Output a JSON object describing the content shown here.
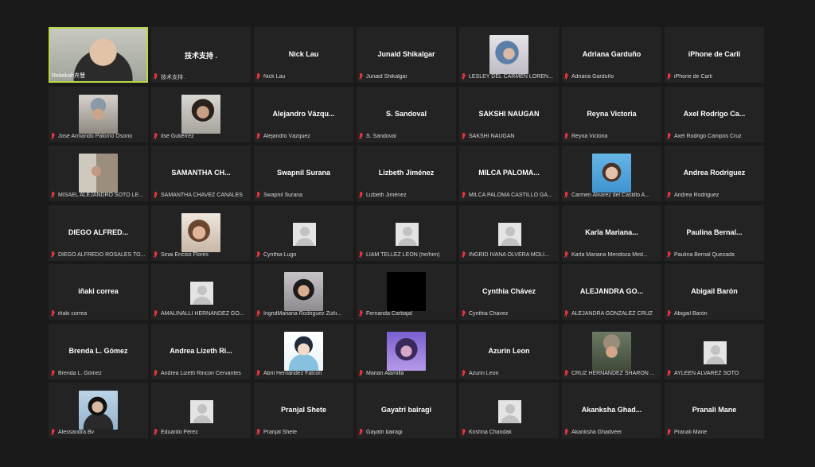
{
  "colors": {
    "background": "#1a1a1a",
    "tile": "#232323",
    "active_speaker_border": "#b8d94a",
    "muted_mic": "#e0353b"
  },
  "participants": [
    {
      "label": "Rebekah卉慧",
      "center": "",
      "avatar": "photo",
      "photo": "woman-glasses",
      "muted": false,
      "active": true
    },
    {
      "label": "技术支持 .",
      "center": "技术支持 .",
      "avatar": "none",
      "muted": true
    },
    {
      "label": "Nick Lau",
      "center": "Nick Lau",
      "avatar": "none",
      "muted": true
    },
    {
      "label": "Junaid Shikalgar",
      "center": "Junaid Shikalgar",
      "avatar": "none",
      "muted": true
    },
    {
      "label": "LESLEY DEL CARMEN LOREN...",
      "center": "",
      "avatar": "photo",
      "photo": "blue-hair",
      "muted": true
    },
    {
      "label": "Adriana Garduño",
      "center": "Adriana Garduño",
      "avatar": "none",
      "muted": true
    },
    {
      "label": "iPhone de Carli",
      "center": "iPhone de Carli",
      "avatar": "none",
      "muted": true
    },
    {
      "label": "Jose Armando Palomo Osorio",
      "center": "",
      "avatar": "photo",
      "photo": "man-cap",
      "muted": true
    },
    {
      "label": "Ilse Gutiérrez",
      "center": "",
      "avatar": "photo",
      "photo": "woman-dark",
      "muted": true
    },
    {
      "label": "Alejandro Vázquez",
      "center": "Alejandro  Vázqu...",
      "avatar": "none",
      "muted": true
    },
    {
      "label": "S. Sandoval",
      "center": "S. Sandoval",
      "avatar": "none",
      "muted": true
    },
    {
      "label": "SAKSHI NAUGAN",
      "center": "SAKSHI NAUGAN",
      "avatar": "none",
      "muted": true
    },
    {
      "label": "Reyna Victoria",
      "center": "Reyna Victoria",
      "avatar": "none",
      "muted": true
    },
    {
      "label": "Axel Rodrigo Campos Cruz",
      "center": "Axel Rodrigo Ca...",
      "avatar": "none",
      "muted": true
    },
    {
      "label": "MISAEL ALEJANDRO SOTO LE...",
      "center": "",
      "avatar": "photo",
      "photo": "man-room",
      "muted": true
    },
    {
      "label": "SAMANTHA CHAVEZ CANALES",
      "center": "SAMANTHA  CH...",
      "avatar": "none",
      "muted": true
    },
    {
      "label": "Swapnil Surana",
      "center": "Swapnil Surana",
      "avatar": "none",
      "muted": true
    },
    {
      "label": "Lizbeth Jiménez",
      "center": "Lizbeth Jiménez",
      "avatar": "none",
      "muted": true
    },
    {
      "label": "MILCA PALOMA CASTILLO GA...",
      "center": "MILCA PALOMA...",
      "avatar": "none",
      "muted": true
    },
    {
      "label": "Carmen Alvarez del Castillo A...",
      "center": "",
      "avatar": "photo",
      "photo": "woman-blue",
      "muted": true
    },
    {
      "label": "Andrea Rodriguez",
      "center": "Andrea Rodriguez",
      "avatar": "none",
      "muted": true
    },
    {
      "label": "DIEGO ALFREDO ROSALES TO...",
      "center": "DIEGO ALFRED...",
      "avatar": "none",
      "muted": true
    },
    {
      "label": "Sinai Enciso Flores",
      "center": "",
      "avatar": "photo",
      "photo": "woman-smile",
      "muted": true
    },
    {
      "label": "Cynthia Lugo",
      "center": "",
      "avatar": "default",
      "muted": true
    },
    {
      "label": "LIAM TELLEZ LEON (he/him)",
      "center": "",
      "avatar": "default",
      "muted": true
    },
    {
      "label": "INGRID IVANA OLVERA MOLI...",
      "center": "",
      "avatar": "default",
      "muted": true
    },
    {
      "label": "Karla Mariana Mendoza Med...",
      "center": "Karla  Mariana...",
      "avatar": "none",
      "muted": true
    },
    {
      "label": "Paulina Bernal Quezada",
      "center": "Paulina  Bernal...",
      "avatar": "none",
      "muted": true
    },
    {
      "label": "iñaki correa",
      "center": "iñaki correa",
      "avatar": "none",
      "muted": true
    },
    {
      "label": "AMALINALLI HERNANDEZ GO...",
      "center": "",
      "avatar": "default",
      "muted": true
    },
    {
      "label": "IngridMariana Rodriguez Zúñi...",
      "center": "",
      "avatar": "photo",
      "photo": "girl-peace",
      "muted": true
    },
    {
      "label": "Fernanda Carbajal",
      "center": "",
      "avatar": "black",
      "muted": true
    },
    {
      "label": "Cynthia Chávez",
      "center": "Cynthia Chávez",
      "avatar": "none",
      "muted": true
    },
    {
      "label": "ALEJANDRA GONZALEZ CRUZ",
      "center": "ALEJANDRA  GO...",
      "avatar": "none",
      "muted": true
    },
    {
      "label": "Abigail Barón",
      "center": "Abigail Barón",
      "avatar": "none",
      "muted": true
    },
    {
      "label": "Brenda L. Gómez",
      "center": "Brenda L. Gómez",
      "avatar": "none",
      "muted": true
    },
    {
      "label": "Andrea Lizeth Rincon Cervantes",
      "center": "Andrea  Lizeth  Ri...",
      "avatar": "none",
      "muted": true
    },
    {
      "label": "Abril Hernández Falcón",
      "center": "",
      "avatar": "photo",
      "photo": "cartoon",
      "muted": true
    },
    {
      "label": "Marian Alamilla",
      "center": "",
      "avatar": "photo",
      "photo": "purple-girl",
      "muted": true
    },
    {
      "label": "Azurin Leon",
      "center": "Azurin Leon",
      "avatar": "none",
      "muted": true
    },
    {
      "label": "CRUZ HERNANDEZ SHARON ...",
      "center": "",
      "avatar": "photo",
      "photo": "woman-beanie",
      "muted": true
    },
    {
      "label": "AYLEEN ALVAREZ SOTO",
      "center": "",
      "avatar": "default",
      "muted": true
    },
    {
      "label": "Alessandra Bv",
      "center": "",
      "avatar": "photo",
      "photo": "woman-glasses2",
      "muted": true
    },
    {
      "label": "Eduardo Pérez",
      "center": "",
      "avatar": "default",
      "muted": true
    },
    {
      "label": "Pranjal Shete",
      "center": "Pranjal Shete",
      "avatar": "none",
      "muted": true
    },
    {
      "label": "Gayatri bairagi",
      "center": "Gayatri bairagi",
      "avatar": "none",
      "muted": true
    },
    {
      "label": "Krishna Chandak",
      "center": "",
      "avatar": "default",
      "muted": true
    },
    {
      "label": "Akanksha Ghadveer",
      "center": "Akanksha  Ghad...",
      "avatar": "none",
      "muted": true
    },
    {
      "label": "Pranali Mane",
      "center": "Pranali Mane",
      "avatar": "none",
      "muted": true
    }
  ]
}
